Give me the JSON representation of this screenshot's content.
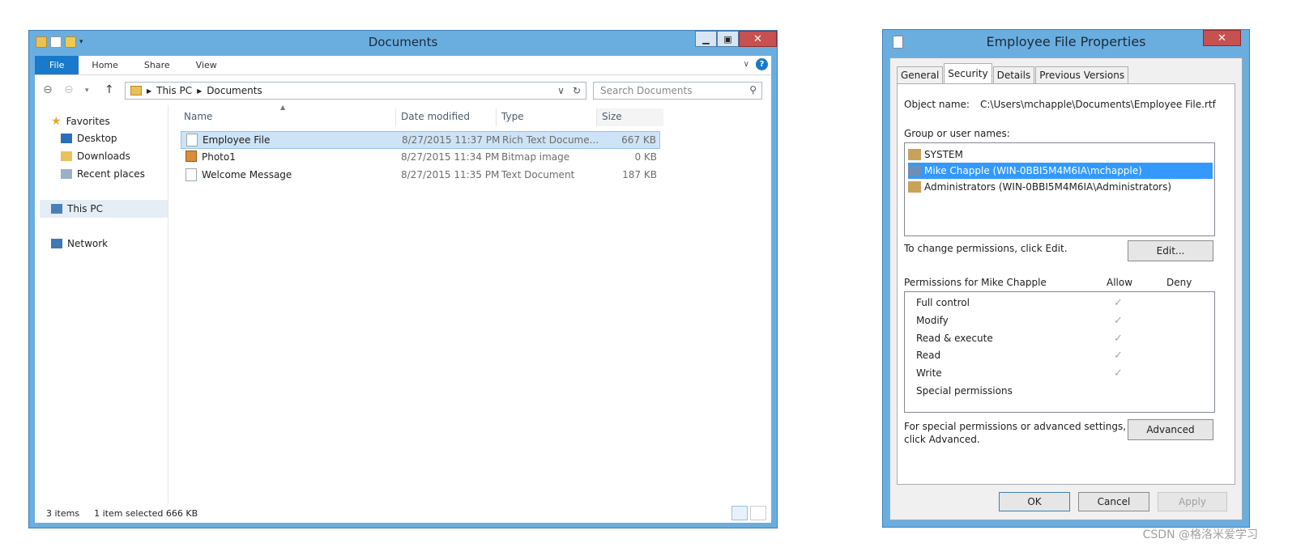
{
  "explorer": {
    "title": "Documents",
    "ribbon_tabs": [
      "File",
      "Home",
      "Share",
      "View"
    ],
    "address": {
      "root": "This PC",
      "folder": "Documents"
    },
    "search_placeholder": "Search Documents",
    "sidebar": {
      "favorites": "Favorites",
      "items": [
        "Desktop",
        "Downloads",
        "Recent places"
      ],
      "this_pc": "This PC",
      "network": "Network"
    },
    "columns": [
      "Name",
      "Date modified",
      "Type",
      "Size"
    ],
    "files": [
      {
        "name": "Employee File",
        "date": "8/27/2015 11:37 PM",
        "type": "Rich Text Docume...",
        "size": "667 KB"
      },
      {
        "name": "Photo1",
        "date": "8/27/2015 11:34 PM",
        "type": "Bitmap image",
        "size": "0 KB"
      },
      {
        "name": "Welcome Message",
        "date": "8/27/2015 11:35 PM",
        "type": "Text Document",
        "size": "187 KB"
      }
    ],
    "status": {
      "count": "3 items",
      "selected": "1 item selected",
      "size": "666 KB"
    }
  },
  "properties": {
    "title": "Employee File Properties",
    "tabs": [
      "General",
      "Security",
      "Details",
      "Previous Versions"
    ],
    "object_label": "Object name:",
    "object_value": "C:\\Users\\mchapple\\Documents\\Employee File.rtf",
    "group_label": "Group or user names:",
    "users": [
      "SYSTEM",
      "Mike Chapple (WIN-0BBI5M4M6IA\\mchapple)",
      "Administrators (WIN-0BBI5M4M6IA\\Administrators)"
    ],
    "change_text": "To change permissions, click Edit.",
    "edit_button": "Edit...",
    "perms_label": "Permissions for Mike Chapple",
    "allow": "Allow",
    "deny": "Deny",
    "permissions": [
      "Full control",
      "Modify",
      "Read & execute",
      "Read",
      "Write",
      "Special permissions"
    ],
    "allowed_checks": [
      true,
      true,
      true,
      true,
      true,
      false
    ],
    "special_text_1": "For special permissions or advanced settings,",
    "special_text_2": "click Advanced.",
    "advanced_button": "Advanced",
    "ok": "OK",
    "cancel": "Cancel",
    "apply": "Apply"
  },
  "watermark": "CSDN @格洛米爱学习"
}
